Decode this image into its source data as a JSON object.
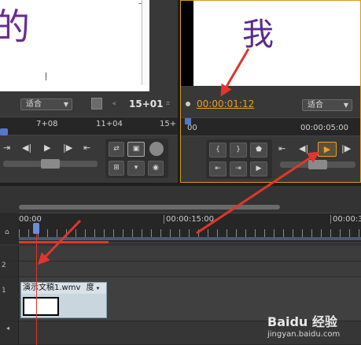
{
  "source": {
    "frame_char": "的",
    "fit_label": "适合",
    "timecode": "15+01",
    "ruler_labels": [
      "7+08",
      "11+04",
      "15+"
    ]
  },
  "program": {
    "frame_char": "我",
    "timecode": "00:00:01:12",
    "fit_label": "适合",
    "ruler_labels": [
      "00",
      "00:00:05:00"
    ]
  },
  "timeline": {
    "ruler_labels": [
      "00:00",
      "00:00:15:00",
      "00:00:3"
    ],
    "track_labels": [
      "2",
      "1"
    ],
    "clip_name": "演示文稿1.wmv",
    "clip_effect": "度"
  },
  "watermark": {
    "brand": "Baidu 经验",
    "url": "jingyan.baidu.com"
  },
  "colors": {
    "accent": "#e8a024",
    "arrow_red": "#e0362c",
    "clip_text": "#6a2d8f"
  },
  "icons": [
    "step-back-icon",
    "play-icon",
    "step-forward-icon",
    "insert-icon",
    "overlay-icon",
    "export-frame-icon",
    "mark-in-icon",
    "mark-out-icon"
  ]
}
